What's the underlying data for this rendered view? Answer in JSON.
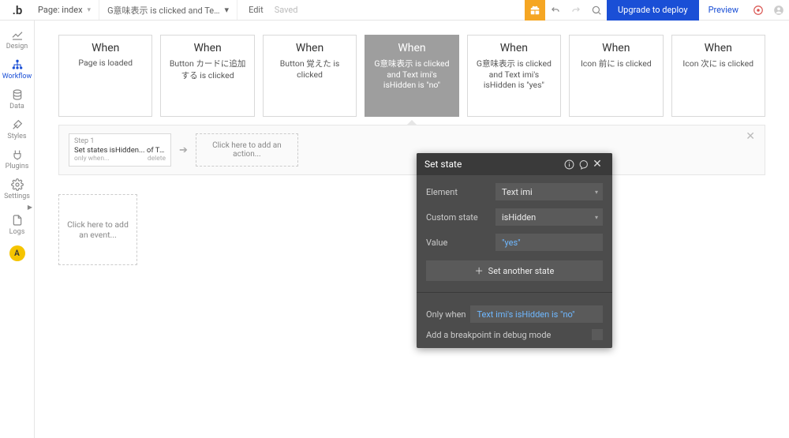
{
  "topbar": {
    "page_label_prefix": "Page:",
    "page_name": "index",
    "breadcrumb": "G意味表示 is clicked and Text imi...",
    "edit_label": "Edit",
    "saved_label": "Saved",
    "upgrade_label": "Upgrade to deploy",
    "preview_label": "Preview"
  },
  "sidebar": {
    "items": [
      {
        "label": "Design"
      },
      {
        "label": "Workflow"
      },
      {
        "label": "Data"
      },
      {
        "label": "Styles"
      },
      {
        "label": "Plugins"
      },
      {
        "label": "Settings"
      },
      {
        "label": "Logs"
      }
    ],
    "avatar_initial": "A"
  },
  "events": [
    {
      "when": "When",
      "desc": "Page is loaded"
    },
    {
      "when": "When",
      "desc": "Button カードに追加する is clicked"
    },
    {
      "when": "When",
      "desc": "Button 覚えた is clicked"
    },
    {
      "when": "When",
      "desc": "G意味表示 is clicked and Text imi's isHidden is \"no\""
    },
    {
      "when": "When",
      "desc": "G意味表示 is clicked and Text imi's isHidden is \"yes\""
    },
    {
      "when": "When",
      "desc": "Icon 前に is clicked"
    },
    {
      "when": "When",
      "desc": "Icon 次に is clicked"
    }
  ],
  "step": {
    "line1": "Step 1",
    "line2": "Set states isHidden... of Text imi",
    "only_when": "only when...",
    "delete": "delete"
  },
  "add_action": "Click here to add an action...",
  "add_event": "Click here to add an event...",
  "panel": {
    "title": "Set state",
    "rows": {
      "element_label": "Element",
      "element_value": "Text imi",
      "custom_state_label": "Custom state",
      "custom_state_value": "isHidden",
      "value_label": "Value",
      "value_value": "\"yes\""
    },
    "add_another_label": "Set another state",
    "only_when_label": "Only when",
    "only_when_value": "Text imi's isHidden is \"no\"",
    "breakpoint_label": "Add a breakpoint in debug mode"
  }
}
